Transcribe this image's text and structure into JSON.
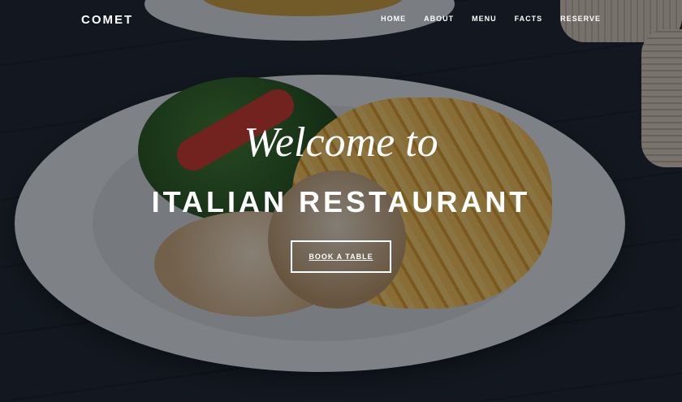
{
  "nav": {
    "logo": "COMET",
    "items": [
      "HOME",
      "ABOUT",
      "MENU",
      "FACTS",
      "RESERVE"
    ]
  },
  "hero": {
    "welcome": "Welcome to",
    "title": "ITALIAN RESTAURANT",
    "cta": "BOOK A TABLE"
  },
  "colors": {
    "overlay": "#0b1016",
    "text": "#ffffff"
  }
}
